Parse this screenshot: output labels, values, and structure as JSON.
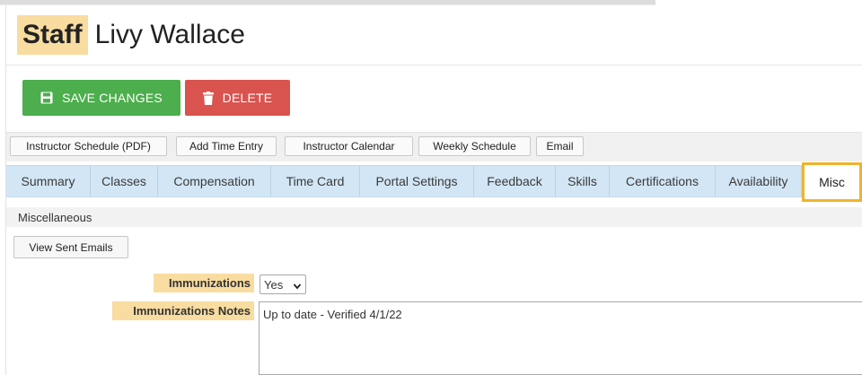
{
  "header": {
    "title_prefix": "Staff",
    "title_name": "Livy Wallace"
  },
  "actions": {
    "save_label": "SAVE CHANGES",
    "delete_label": "DELETE"
  },
  "toolbar": {
    "buttons": [
      "Instructor Schedule (PDF)",
      "Add Time Entry",
      "Instructor Calendar",
      "Weekly Schedule",
      "Email"
    ]
  },
  "tabs": [
    "Summary",
    "Classes",
    "Compensation",
    "Time Card",
    "Portal Settings",
    "Feedback",
    "Skills",
    "Certifications",
    "Availability",
    "Misc"
  ],
  "active_tab": "Misc",
  "section": {
    "title": "Miscellaneous",
    "view_sent_emails_label": "View Sent Emails"
  },
  "form": {
    "immunizations_label": "Immunizations",
    "immunizations_value": "Yes",
    "notes_label": "Immunizations Notes",
    "notes_value": "Up to date - Verified 4/1/22"
  },
  "colors": {
    "highlight": "#f8dca0",
    "save_green": "#4cae4c",
    "delete_red": "#d9534f",
    "tab_bar": "#d3e6f5",
    "active_tab_outline": "#f0b429"
  },
  "icons": {
    "save": "save-icon",
    "delete": "trash-icon",
    "select": "chevron-down-icon"
  }
}
